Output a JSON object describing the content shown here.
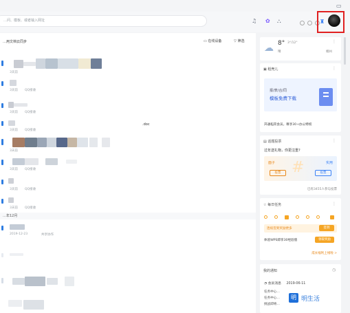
{
  "colors": {
    "accent": "#3b82f6",
    "warn": "#f5a524",
    "highlight": "#e02020"
  },
  "search": {
    "placeholder": "…问、模板、或者输入网址"
  },
  "toolbar": {
    "icons": [
      "headset-icon",
      "skin-icon",
      "network-icon"
    ]
  },
  "main": {
    "section_title": "…用文档云同步",
    "device_link": "在线设备",
    "filter_label": "筛选",
    "files": [
      {
        "meta": "3天前",
        "source": "QQ接收"
      },
      {
        "meta": "3天前",
        "source": "QQ接收"
      },
      {
        "meta": "3天前",
        "source": "QQ接收"
      },
      {
        "meta": "3天前",
        "source": "QQ接收"
      },
      {
        "meta": "3天前",
        "source": "QQ接收"
      },
      {
        "meta": "3天前",
        "source": "QQ接收"
      },
      {
        "meta": "3天前",
        "source": "QQ接收"
      },
      {
        "meta": "3天前",
        "source": "QQ接收"
      }
    ],
    "doc_suffix": ".doc",
    "month_label": "…年12月",
    "dec_file": {
      "date": "2019-12-23",
      "source": "共享协作"
    }
  },
  "weather": {
    "temp": "8°",
    "range": "3°/12°",
    "cond": "晴",
    "city": "端州"
  },
  "template_card": {
    "header": "稻壳儿",
    "banner_line1": "报/表/合/同",
    "banner_line2": "模板免费下载",
    "footer": "开通稻壳会员，尊享30+办公特权"
  },
  "topic_card": {
    "header": "话题投票",
    "question": "过年送礼物，你更注重?",
    "left_option": "面子",
    "right_option": "实用",
    "vote_left": "投票",
    "vote_right": "投票",
    "count": "已有3455人参与投票"
  },
  "task_card": {
    "header": "每日任务",
    "streak_text": "连续签到奖励更多",
    "sign_btn": "签到",
    "experience": "体验WPS即享30经验值",
    "go_btn": "领取奖励",
    "more": "成长福利上线啦 >"
  },
  "notify_card": {
    "header": "我的通知",
    "item_title": "会员消息",
    "item_date": "2019-06-11",
    "line1": "任务中心…",
    "line2": "任务中心…",
    "line3": "挑战即将…"
  },
  "watermark": "明生活"
}
